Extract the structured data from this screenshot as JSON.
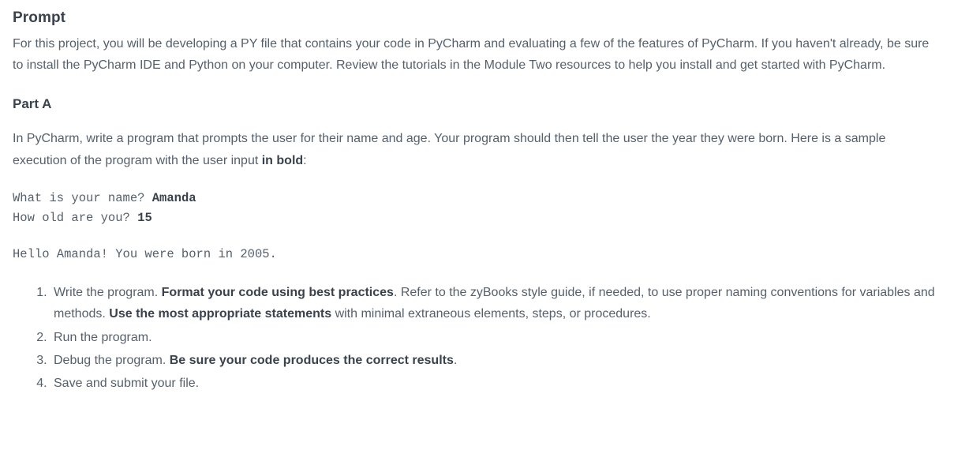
{
  "prompt": {
    "heading": "Prompt",
    "intro": "For this project, you will be developing a PY file that contains your code in PyCharm and evaluating a few of the features of PyCharm. If you haven't already, be sure to install the PyCharm IDE and Python on your computer. Review the tutorials in the Module Two resources to help you install and get started with PyCharm."
  },
  "partA": {
    "heading": "Part A",
    "intro_prefix": "In PyCharm, write a program that prompts the user for their name and age. Your program should then tell the user the year they were born. Here is a sample execution of the program with the user input ",
    "intro_bold": "in bold",
    "intro_suffix": ":",
    "sample": {
      "line1_prompt": "What is your name? ",
      "line1_input": "Amanda",
      "line2_prompt": "How old are you? ",
      "line2_input": "15",
      "output": "Hello Amanda! You were born in 2005."
    },
    "steps": {
      "s1_a": "Write the program. ",
      "s1_b": "Format your code using best practices",
      "s1_c": ". Refer to the zyBooks style guide, if needed, to use proper naming conventions for variables and methods. ",
      "s1_d": "Use the most appropriate statements",
      "s1_e": " with minimal extraneous elements, steps, or procedures.",
      "s2": "Run the program.",
      "s3_a": "Debug the program. ",
      "s3_b": "Be sure your code produces the correct results",
      "s3_c": ".",
      "s4": "Save and submit your file."
    }
  }
}
